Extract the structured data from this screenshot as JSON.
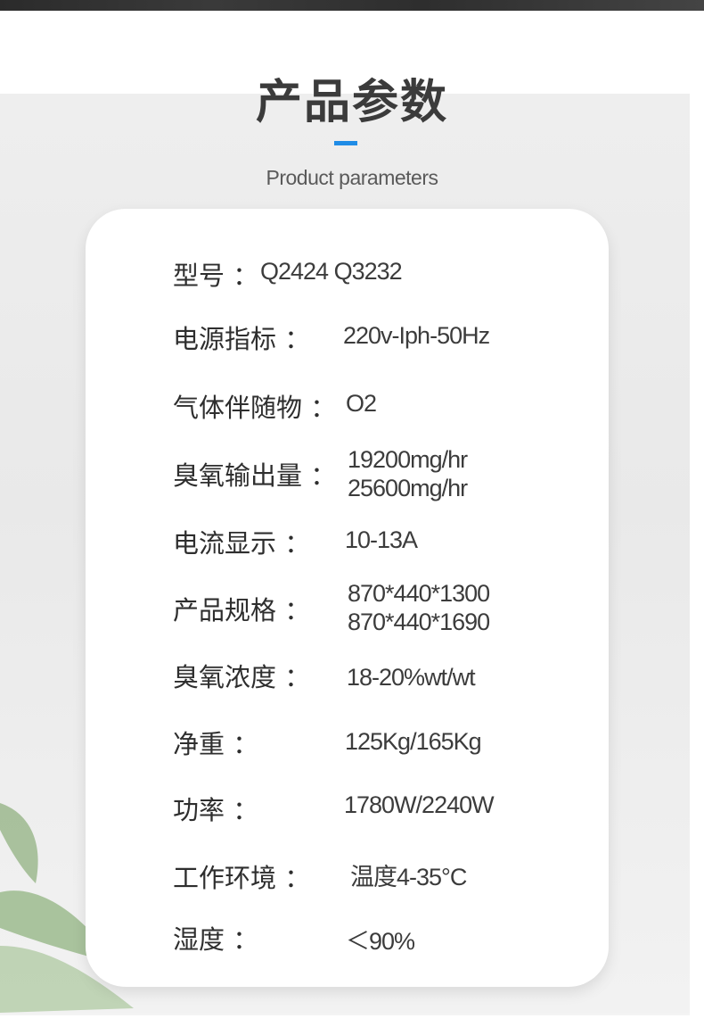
{
  "section": {
    "title": "产品参数",
    "subtitle": "Product parameters",
    "accent_color": "#1f8ce6"
  },
  "params": [
    {
      "label": "型号 ：",
      "value": "Q2424 Q3232"
    },
    {
      "label": "电源指标 ：",
      "value": "220v-Iph-50Hz"
    },
    {
      "label": "气体伴随物 ：",
      "value": "O2"
    },
    {
      "label": "臭氧输出量 ：",
      "values": [
        "19200mg/hr",
        "25600mg/hr"
      ]
    },
    {
      "label": "电流显示 ：",
      "value": "10-13A"
    },
    {
      "label": "产品规格 ：",
      "values": [
        "870*440*1300",
        "870*440*1690"
      ]
    },
    {
      "label": "臭氧浓度 ：",
      "value": "18-20%wt/wt"
    },
    {
      "label": "净重 ：",
      "value": "125Kg/165Kg"
    },
    {
      "label": "功率 ：",
      "value": "1780W/2240W"
    },
    {
      "label": "工作环境 ：",
      "value": "温度4-35°C"
    },
    {
      "label": "湿度 ：",
      "value": "＜90%"
    }
  ]
}
